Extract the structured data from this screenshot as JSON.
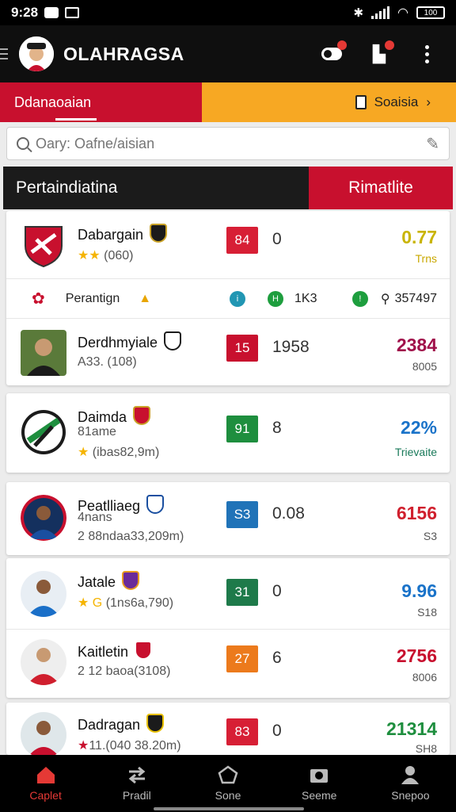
{
  "status_bar": {
    "time": "9:28",
    "battery": "100"
  },
  "app": {
    "title": "OLAHRAGSA"
  },
  "tabs": {
    "left": "Ddanaoaian",
    "right": "Soaisia"
  },
  "search": {
    "placeholder": "Oary: Oafne/aisian"
  },
  "section": {
    "left": "Pertaindiatina",
    "right": "Rimatlite"
  },
  "colors": {
    "red": "#c8102e",
    "orange": "#f7a823",
    "dark": "#1b1b1b"
  },
  "players": [
    {
      "name": "Dabargain",
      "sub": "(060)",
      "stars": "★★",
      "rank": "84",
      "rank_color": "#d71f35",
      "mid": "0",
      "value": "0.77",
      "value_color": "#c9b400",
      "sub_value": "Trns",
      "sub_value_color": "#c9a800"
    },
    {
      "name": "Derdhmyiale",
      "sub": "A33. (108)",
      "stars": "",
      "rank": "15",
      "rank_color": "#c8102e",
      "mid": "1958",
      "value": "2384",
      "value_color": "#a0104a",
      "sub_value": "8005",
      "sub_value_color": "#555555"
    },
    {
      "name": "Daimda",
      "sub": "81ame",
      "sub2": "(ibas82,9m)",
      "stars": "★",
      "rank": "91",
      "rank_color": "#1e8e3e",
      "mid": "8",
      "value": "22%",
      "value_color": "#1a73c9",
      "sub_value": "Trievaite",
      "sub_value_color": "#1a7a5a"
    },
    {
      "name": "Peatlliaeg",
      "sub": "4nans",
      "sub2": "2 88ndaa33,209m)",
      "stars": "",
      "rank": "S3",
      "rank_color": "#2073b8",
      "mid": "0.08",
      "value": "6156",
      "value_color": "#d0202e",
      "sub_value": "S3",
      "sub_value_color": "#555555"
    },
    {
      "name": "Jatale",
      "sub": "(1ns6a,790)",
      "stars": "★ G",
      "rank": "31",
      "rank_color": "#1e7a4a",
      "mid": "0",
      "value": "9.96",
      "value_color": "#1a73c9",
      "sub_value": "S18",
      "sub_value_color": "#555555"
    },
    {
      "name": "Kaitletin",
      "sub": "2 12 baoa(3108)",
      "stars": "",
      "rank": "27",
      "rank_color": "#ec7a1c",
      "mid": "6",
      "value": "2756",
      "value_color": "#c8102e",
      "sub_value": "8006",
      "sub_value_color": "#555555"
    },
    {
      "name": "Dadragan",
      "sub": "11.(040 38.20m)",
      "stars": "★",
      "rank": "83",
      "rank_color": "#d71f35",
      "mid": "0",
      "value": "21314",
      "value_color": "#1e8e3e",
      "sub_value": "SH8",
      "sub_value_color": "#555555"
    }
  ],
  "stats": {
    "label": "Perantign",
    "v1": "1K3",
    "v2": "357497"
  },
  "nav": [
    {
      "label": "Caplet",
      "icon": "home-icon",
      "active": true
    },
    {
      "label": "Pradil",
      "icon": "swap-icon",
      "active": false
    },
    {
      "label": "Sone",
      "icon": "pentagon-icon",
      "active": false
    },
    {
      "label": "Seeme",
      "icon": "camera-icon",
      "active": false
    },
    {
      "label": "Snepoo",
      "icon": "person-icon",
      "active": false
    }
  ]
}
